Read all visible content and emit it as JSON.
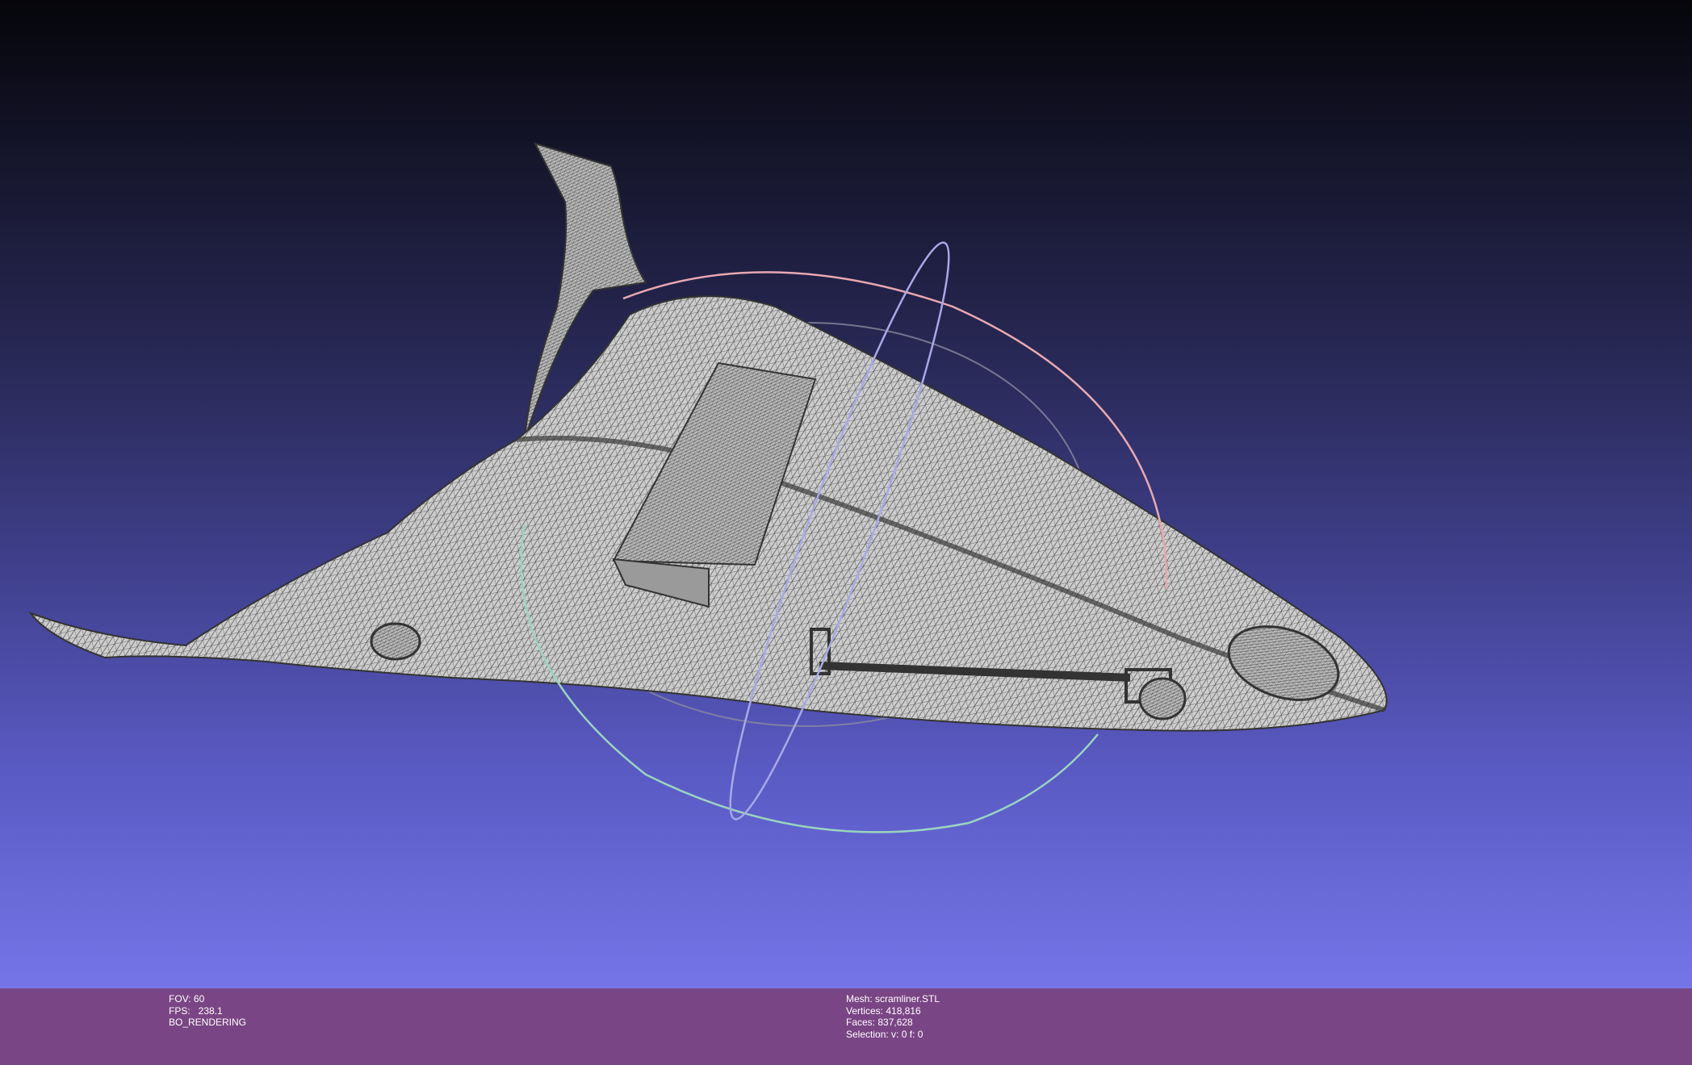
{
  "viewer": {
    "mesh_object": "mesh-wireframe-spaceplane",
    "trackball": {
      "colors": {
        "x_ring": "#e8a8b0",
        "y_ring": "#a8a8e8",
        "z_ring": "#9ad4c0",
        "inner": "#8a8aa0"
      }
    },
    "background": {
      "top": "#05050a",
      "bottom": "#7575e8"
    }
  },
  "status_left": {
    "fov": "FOV: 60",
    "fps": "FPS:   238.1",
    "mode": "BO_RENDERING"
  },
  "status_right": {
    "mesh": "Mesh: scramliner.STL",
    "vertices": "Vertices: 418,816",
    "faces": "Faces: 837,628",
    "selection": "Selection: v: 0 f: 0"
  },
  "colors": {
    "infobar": "#7a4585",
    "mesh_fill": "#c9c9c9",
    "wire": "#3a3a3a"
  }
}
